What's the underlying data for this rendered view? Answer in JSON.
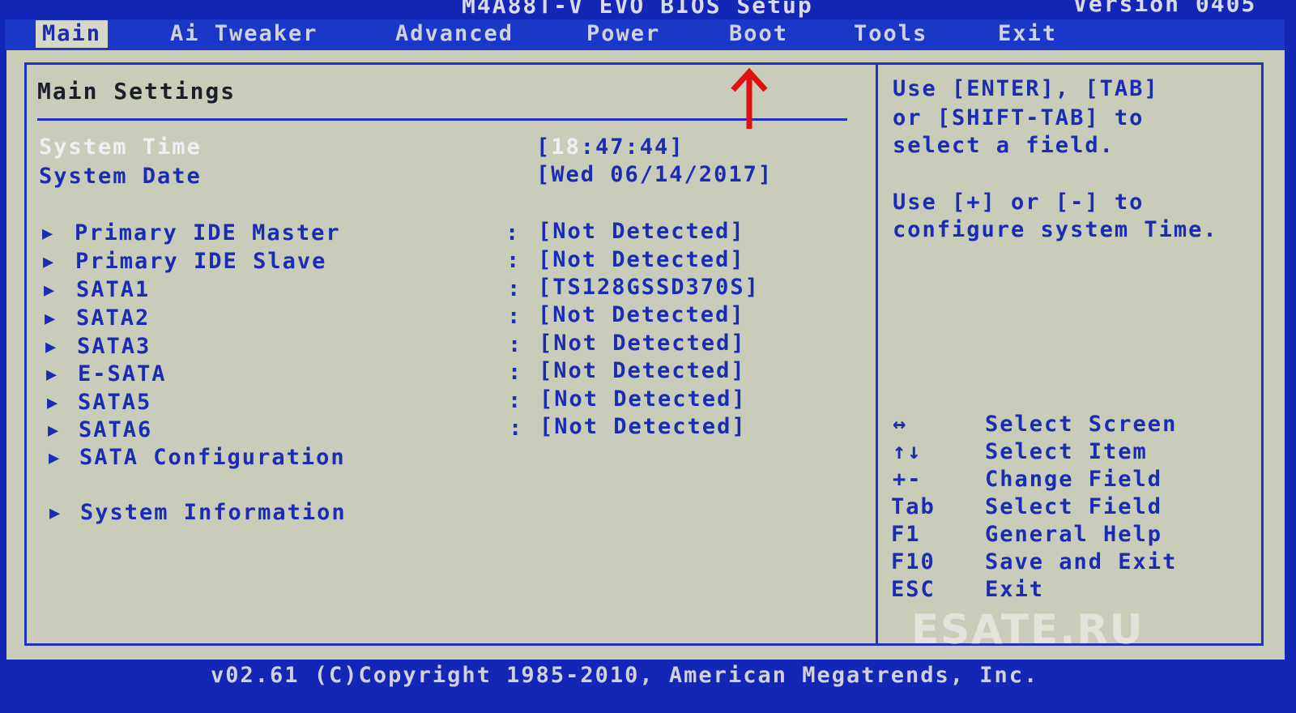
{
  "title": {
    "app": "M4A88T-V EVO BIOS Setup",
    "version": "Version 0405"
  },
  "menu": {
    "tabs": [
      "Main",
      "Ai Tweaker",
      "Advanced",
      "Power",
      "Boot",
      "Tools",
      "Exit"
    ],
    "active": "Main"
  },
  "main": {
    "section_title": "Main Settings",
    "system_time": {
      "label": "System Time",
      "value_open": "[",
      "value_hl": "18",
      "value_rest": ":47:44]"
    },
    "system_date": {
      "label": "System Date",
      "value": "[Wed 06/14/2017]"
    },
    "drives": [
      {
        "label": "Primary IDE Master",
        "value": "[Not Detected]"
      },
      {
        "label": "Primary IDE Slave",
        "value": "[Not Detected]"
      },
      {
        "label": "SATA1",
        "value": "[TS128GSSD370S]"
      },
      {
        "label": "SATA2",
        "value": "[Not Detected]"
      },
      {
        "label": "SATA3",
        "value": "[Not Detected]"
      },
      {
        "label": "E-SATA",
        "value": "[Not Detected]"
      },
      {
        "label": "SATA5",
        "value": "[Not Detected]"
      },
      {
        "label": "SATA6",
        "value": "[Not Detected]"
      }
    ],
    "sata_config": "SATA Configuration",
    "system_info": "System Information"
  },
  "help": {
    "lines": [
      "Use [ENTER], [TAB]",
      "or [SHIFT-TAB] to",
      "select a field.",
      "Use [+] or [-] to",
      "configure system Time."
    ]
  },
  "keys": [
    {
      "key": "↔",
      "desc": "Select Screen"
    },
    {
      "key": "↑↓",
      "desc": "Select Item"
    },
    {
      "key": "+-",
      "desc": "Change Field"
    },
    {
      "key": "Tab",
      "desc": "Select Field"
    },
    {
      "key": "F1",
      "desc": "General Help"
    },
    {
      "key": "F10",
      "desc": "Save and Exit"
    },
    {
      "key": "ESC",
      "desc": "Exit"
    }
  ],
  "watermark": "ESATE.RU",
  "footer": "v02.61 (C)Copyright 1985-2010, American Megatrends, Inc.",
  "colors": {
    "bios_blue": "#1326b5",
    "panel_bg": "#c9ccb8",
    "text_blue": "#1b2cb4",
    "highlight_white": "#eef0f6",
    "annotation_red": "#e01010"
  }
}
